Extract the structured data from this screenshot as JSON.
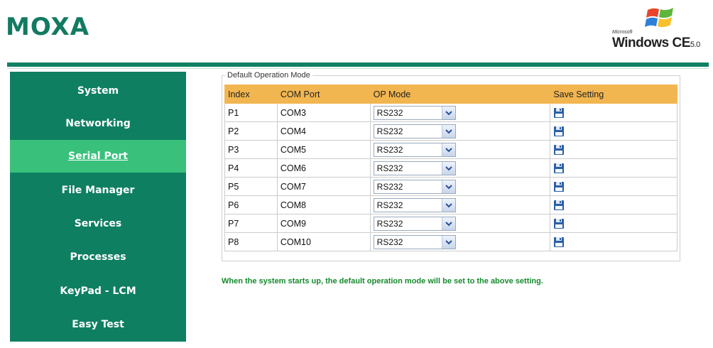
{
  "header": {
    "logo": "MOXA",
    "os_badge": {
      "microsoft": "Microsoft",
      "product": "Windows CE",
      "version": "5.0"
    }
  },
  "sidebar": {
    "items": [
      {
        "label": "System",
        "active": false
      },
      {
        "label": "Networking",
        "active": false
      },
      {
        "label": "Serial Port",
        "active": true
      },
      {
        "label": "File Manager",
        "active": false
      },
      {
        "label": "Services",
        "active": false
      },
      {
        "label": "Processes",
        "active": false
      },
      {
        "label": "KeyPad - LCM",
        "active": false
      },
      {
        "label": "Easy Test",
        "active": false
      }
    ]
  },
  "main": {
    "fieldset_legend": "Default Operation Mode",
    "table": {
      "headers": [
        "Index",
        "COM Port",
        "OP Mode",
        "Save Setting"
      ],
      "rows": [
        {
          "index": "P1",
          "com": "COM3",
          "mode": "RS232"
        },
        {
          "index": "P2",
          "com": "COM4",
          "mode": "RS232"
        },
        {
          "index": "P3",
          "com": "COM5",
          "mode": "RS232"
        },
        {
          "index": "P4",
          "com": "COM6",
          "mode": "RS232"
        },
        {
          "index": "P5",
          "com": "COM7",
          "mode": "RS232"
        },
        {
          "index": "P6",
          "com": "COM8",
          "mode": "RS232"
        },
        {
          "index": "P7",
          "com": "COM9",
          "mode": "RS232"
        },
        {
          "index": "P8",
          "com": "COM10",
          "mode": "RS232"
        }
      ]
    },
    "note": "When the system starts up, the default operation mode will be set to the above setting."
  },
  "colors": {
    "brand_green": "#137a61",
    "sidebar_bg": "#0f7f62",
    "sidebar_active": "#39c17c",
    "table_header": "#f2b650",
    "note_text": "#148a2c"
  },
  "icons": {
    "dropdown": "chevron-down-icon",
    "save": "floppy-disk-icon",
    "os_logo": "windows-flag-icon"
  }
}
